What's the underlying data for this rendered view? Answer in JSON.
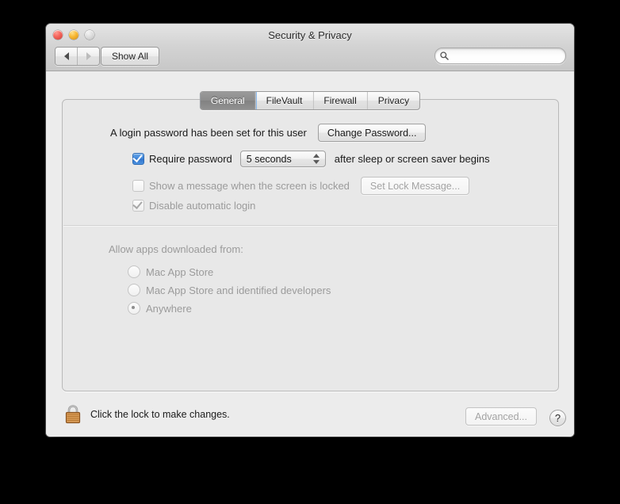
{
  "window": {
    "title": "Security & Privacy",
    "traffic_lights": [
      "close",
      "minimize",
      "zoom"
    ],
    "nav": {
      "back_icon": "back-arrow-icon",
      "forward_icon": "forward-arrow-icon"
    },
    "show_all_label": "Show All",
    "search": {
      "placeholder": "",
      "value": "",
      "icon": "search-icon"
    }
  },
  "tabs": [
    {
      "label": "General",
      "selected": true
    },
    {
      "label": "FileVault",
      "selected": false
    },
    {
      "label": "Firewall",
      "selected": false
    },
    {
      "label": "Privacy",
      "selected": false
    }
  ],
  "general": {
    "password_status": "A login password has been set for this user",
    "change_password_label": "Change Password...",
    "require_password": {
      "label": "Require password",
      "checked": true,
      "delay_value": "5 seconds",
      "suffix": "after sleep or screen saver begins"
    },
    "lock_message": {
      "label": "Show a message when the screen is locked",
      "checked": false,
      "enabled": false,
      "button_label": "Set Lock Message..."
    },
    "disable_auto_login": {
      "label": "Disable automatic login",
      "checked": true,
      "enabled": false
    },
    "allow_apps": {
      "heading": "Allow apps downloaded from:",
      "options": [
        {
          "label": "Mac App Store",
          "selected": false
        },
        {
          "label": "Mac App Store and identified developers",
          "selected": false
        },
        {
          "label": "Anywhere",
          "selected": true
        }
      ]
    }
  },
  "footer": {
    "lock_icon": "closed-padlock-icon",
    "lock_message": "Click the lock to make changes.",
    "advanced_label": "Advanced...",
    "advanced_enabled": false,
    "help_label": "?"
  },
  "colors": {
    "accent_blue": "#3d83d8",
    "tab_selected": "#8c8c8c",
    "lock_body": "#d08a3e",
    "window_bg": "#ececec"
  }
}
